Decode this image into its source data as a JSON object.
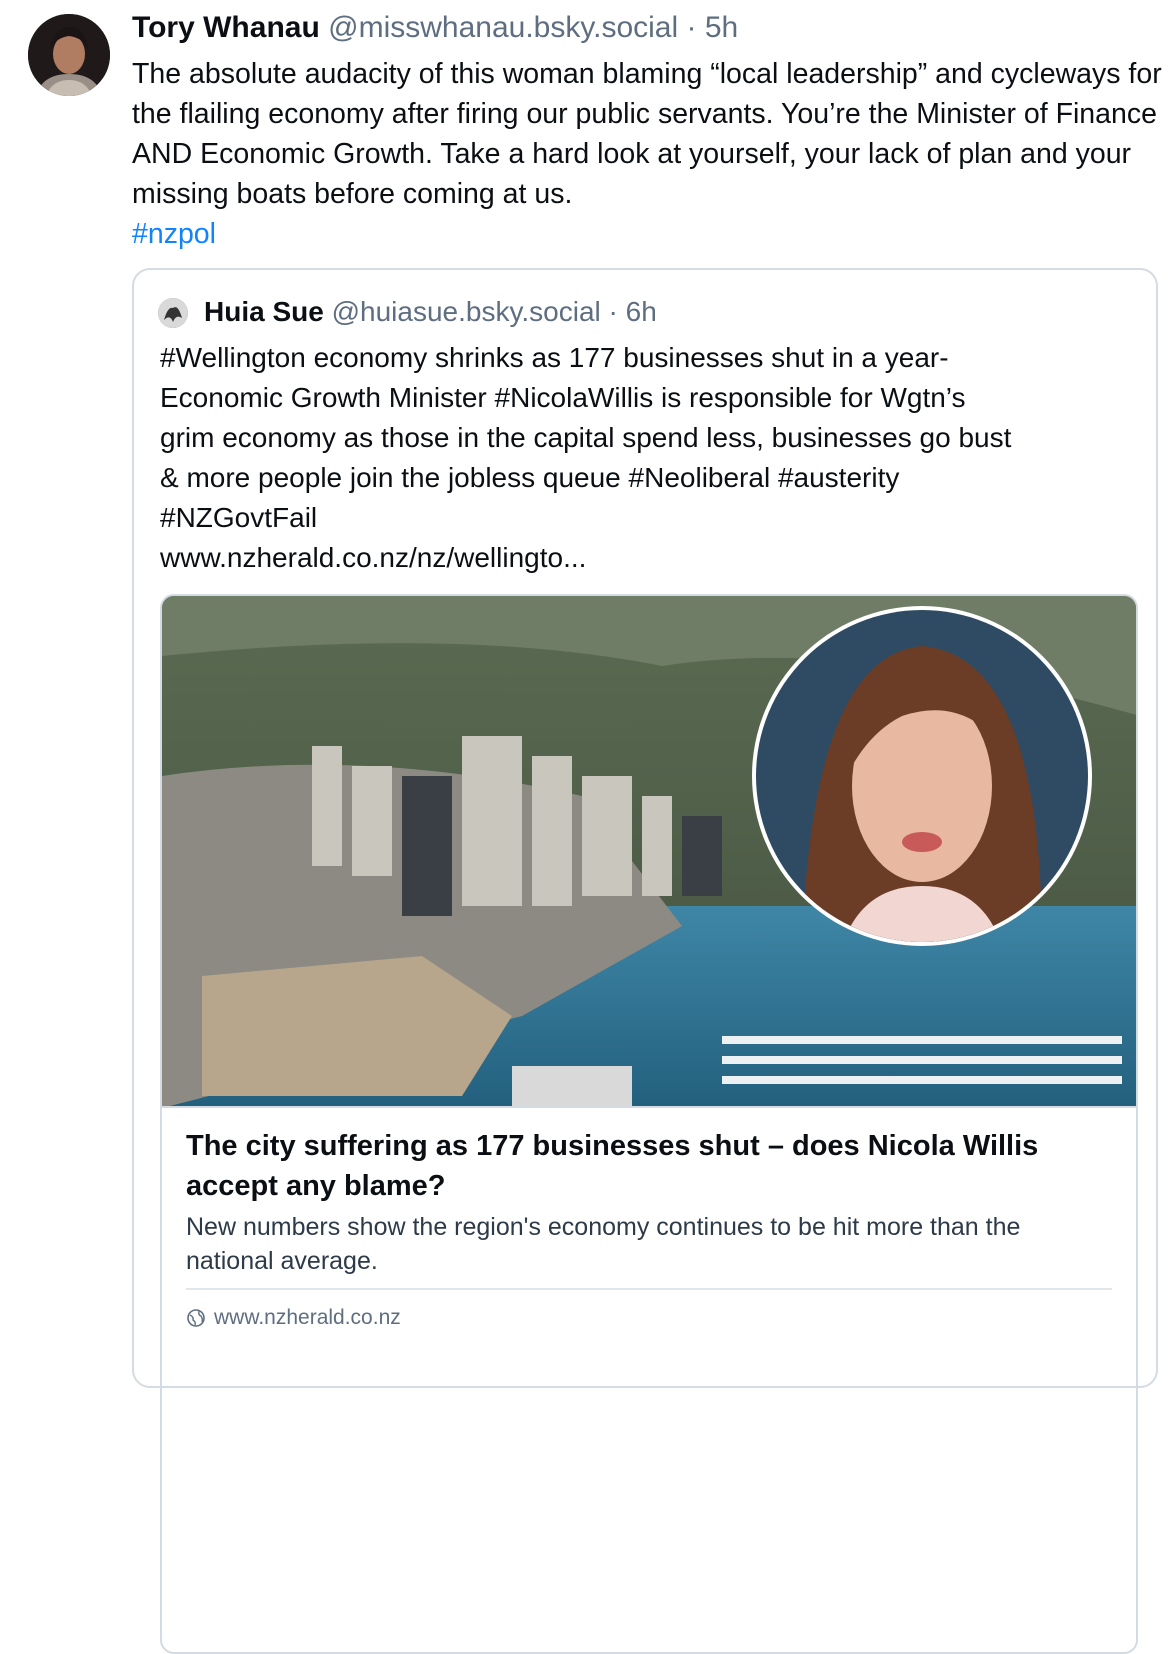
{
  "post": {
    "author_name": "Tory Whanau",
    "author_handle": "@misswhanau.bsky.social",
    "separator": "·",
    "time": "5h",
    "text": "The absolute audacity of this woman blaming “local leadership” and cycleways for the flailing economy after firing our public servants. You’re the Minister of Finance AND Economic Growth. Take a hard look at yourself, your lack of plan and your missing boats before coming at us.",
    "hashtag": "#nzpol"
  },
  "quote": {
    "author_name": "Huia Sue",
    "author_handle": "@huiasue.bsky.social",
    "separator": "·",
    "time": "6h",
    "lines": [
      "#Wellington economy shrinks as 177 businesses shut in a year-",
      "Economic Growth Minister #NicolaWillis is responsible for Wgtn’s",
      "grim economy as those in the capital spend less, businesses go bust",
      "& more people join the jobless queue #Neoliberal #austerity",
      "#NZGovtFail",
      "www.nzherald.co.nz/nz/wellingto..."
    ]
  },
  "link_card": {
    "title": "The city suffering as 177 businesses shut – does Nicola Willis accept any blame?",
    "description": "New numbers show the region's economy continues to be hit more than the national average.",
    "domain": "www.nzherald.co.nz",
    "domain_icon": "globe-icon"
  },
  "colors": {
    "hashtag": "#1083fe",
    "muted": "#5e6e80",
    "border": "#d4dbe2"
  }
}
